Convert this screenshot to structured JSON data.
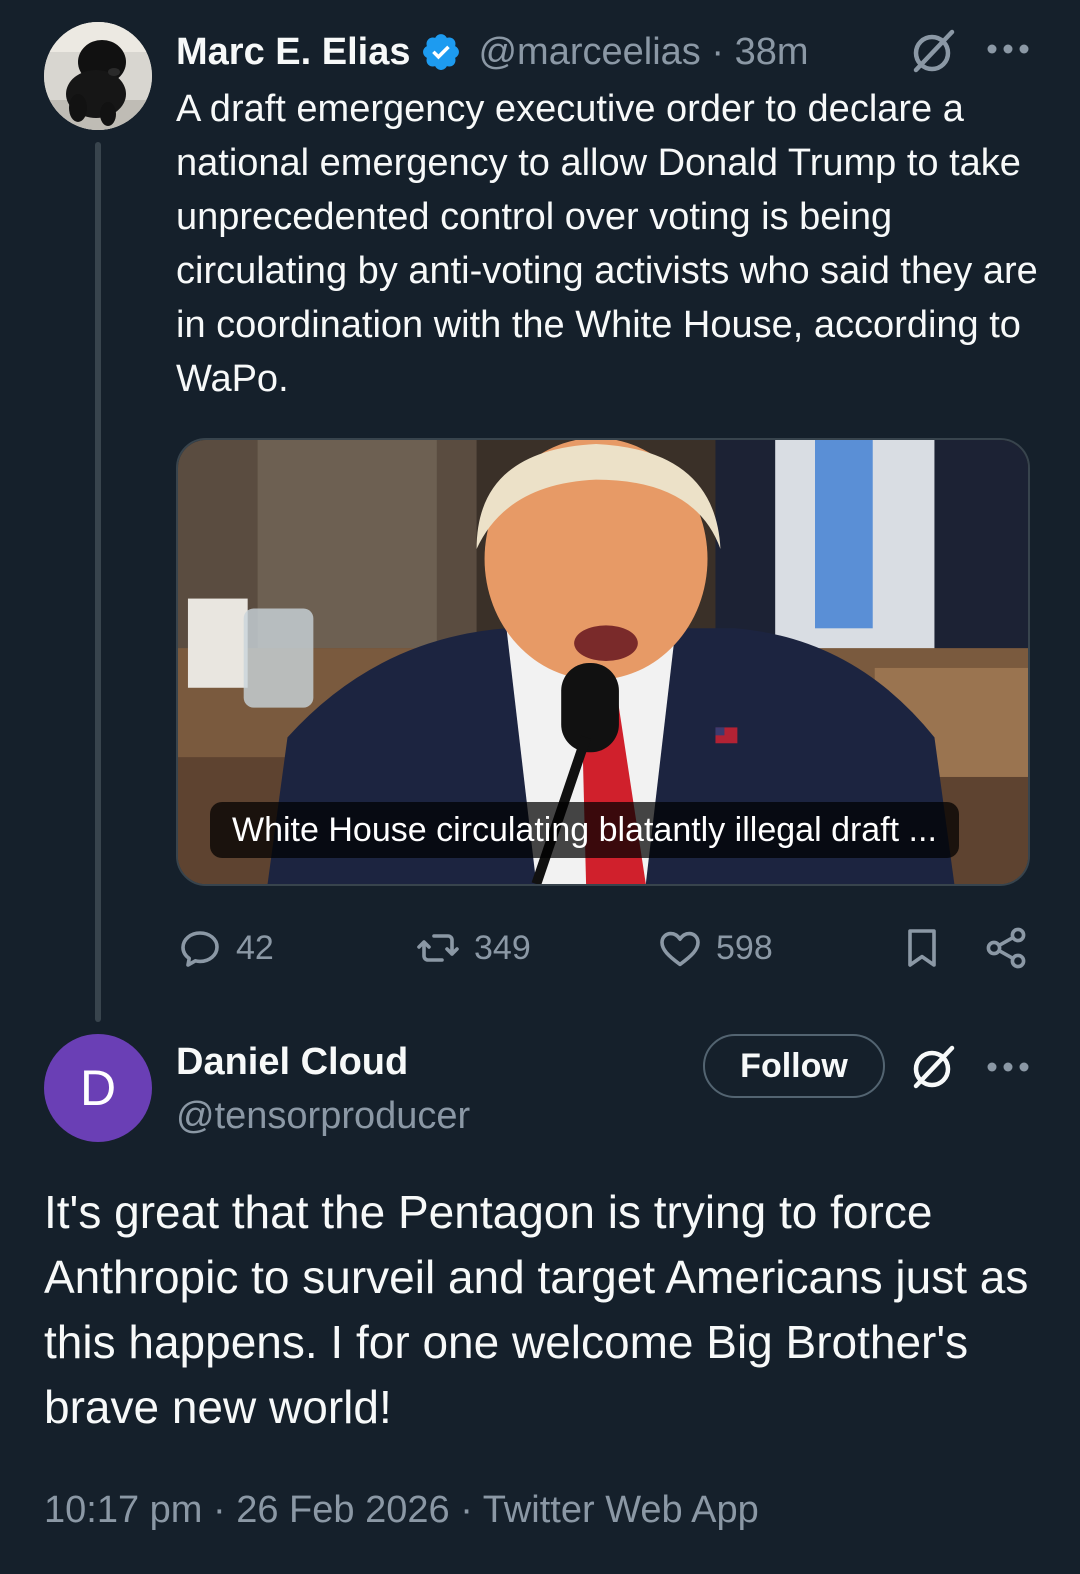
{
  "quoted_tweet": {
    "display_name": "Marc E. Elias",
    "handle": "@marceelias",
    "separator": "·",
    "time_ago": "38m",
    "text": "A draft emergency executive order to declare a national emergency to allow Donald Trump to take unprecedented control over voting is being circulating by anti-voting activists who said they are in coordination with the White House, according to WaPo.",
    "media_caption": "White House circulating blatantly illegal draft ...",
    "replies": "42",
    "reposts": "349",
    "likes": "598",
    "icons": [
      "verified-icon",
      "grok-icon",
      "more-icon",
      "reply-icon",
      "repost-icon",
      "like-icon",
      "bookmark-icon",
      "share-icon"
    ]
  },
  "reply_tweet": {
    "avatar_letter": "D",
    "display_name": "Daniel Cloud",
    "handle": "@tensorproducer",
    "follow_label": "Follow",
    "text": "It's great that the Pentagon is trying to force Anthropic to surveil and target Americans just as this happens. I for one welcome Big Brother's brave new world!",
    "time": "10:17 pm",
    "date": "26 Feb 2026",
    "client": "Twitter Web App",
    "separator": "·"
  },
  "colors": {
    "background": "#15202b",
    "text_primary": "#f7f9f9",
    "text_secondary": "#8b98a5",
    "verified_blue": "#1d9bf0",
    "avatar_purple": "#6a3fb5",
    "border": "#38444d"
  }
}
